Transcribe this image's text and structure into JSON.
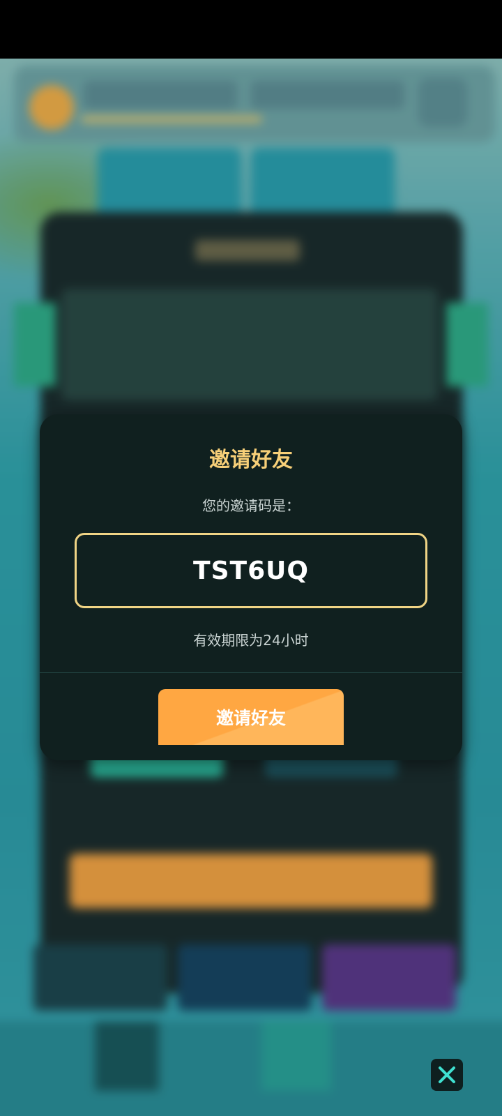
{
  "dialog": {
    "title": "邀请好友",
    "subtitle": "您的邀请码是：",
    "invite_code": "TST6UQ",
    "expiry_text": "有效期限为24小时",
    "button_label": "邀请好友"
  },
  "colors": {
    "title": "#f7cf78",
    "code_border": "#f0d485",
    "button": "#ffa742",
    "dialog_bg": "#10201f"
  },
  "icons": {
    "close": "close-icon"
  }
}
